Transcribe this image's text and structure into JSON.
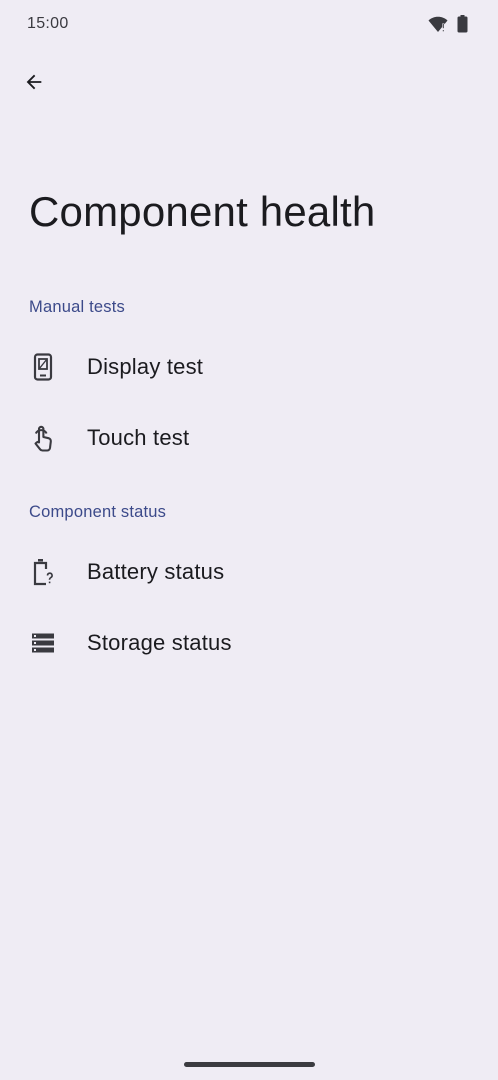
{
  "status_bar": {
    "time": "15:00",
    "icons": [
      "wifi-alert-icon",
      "battery-icon"
    ]
  },
  "toolbar": {
    "back_icon": "arrow-back-icon"
  },
  "page": {
    "title": "Component health"
  },
  "sections": [
    {
      "header": "Manual tests",
      "items": [
        {
          "label": "Display test",
          "icon": "phone-display-icon"
        },
        {
          "label": "Touch test",
          "icon": "touch-hand-icon"
        }
      ]
    },
    {
      "header": "Component status",
      "items": [
        {
          "label": "Battery status",
          "icon": "battery-unknown-icon"
        },
        {
          "label": "Storage status",
          "icon": "storage-icon"
        }
      ]
    }
  ],
  "colors": {
    "background": "#efecf4",
    "section_header": "#3c4a8a",
    "text": "#1b1b1f",
    "icon": "#3a3a40"
  }
}
